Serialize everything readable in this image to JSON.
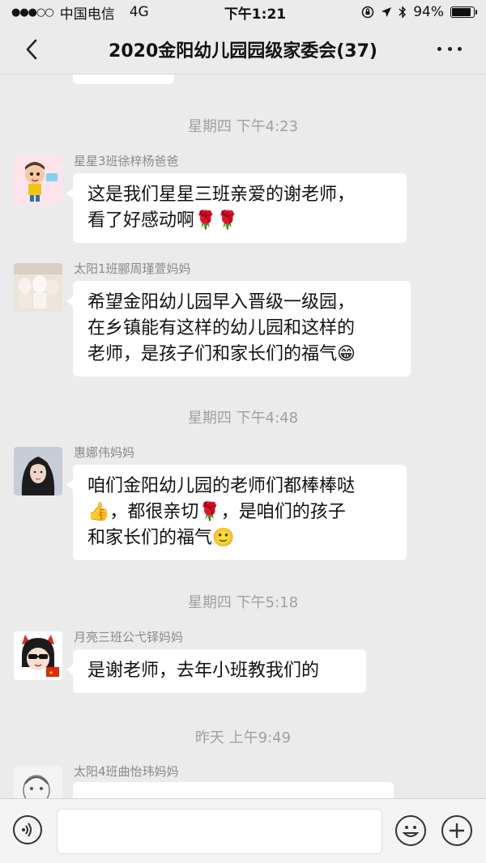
{
  "status": {
    "signal": "●●●○○",
    "carrier": "中国电信",
    "network": "4G",
    "time": "下午1:21",
    "battery_level": 0.94,
    "battery": "94%"
  },
  "nav": {
    "title": "2020金阳幼儿园园级家委会(37)"
  },
  "messages": [
    {
      "timestamp": "星期四 下午4:23",
      "sender": "星星3班徐梓杨爸爸",
      "lines": [
        "这是我们星星三班亲爱的谢老师，",
        "看了好感动啊🌹🌹"
      ]
    },
    {
      "sender": "太阳1班郦周瑾萱妈妈",
      "lines": [
        "希望金阳幼儿园早入晋级一级园，",
        "在乡镇能有这样的幼儿园和这样的",
        "老师，是孩子们和家长们的福气😁"
      ]
    },
    {
      "timestamp": "星期四 下午4:48",
      "sender": "惠娜伟妈妈",
      "lines": [
        "咱们金阳幼儿园的老师们都棒棒哒",
        "👍，都很亲切🌹，是咱们的孩子",
        "和家长们的福气🙂"
      ]
    },
    {
      "timestamp": "星期四 下午5:18",
      "sender": "月亮三班公弋铎妈妈",
      "lines": [
        "是谢老师，去年小班教我们的"
      ]
    },
    {
      "timestamp": "昨天 上午9:49",
      "sender": "太阳4班曲怡玮妈妈",
      "lines": [
        ""
      ]
    }
  ],
  "input": {
    "value": ""
  },
  "colors": {
    "background": "#ebebeb",
    "bubble": "#ffffff",
    "timestamp": "#a0a0a0",
    "sender": "#8a8a8a"
  }
}
